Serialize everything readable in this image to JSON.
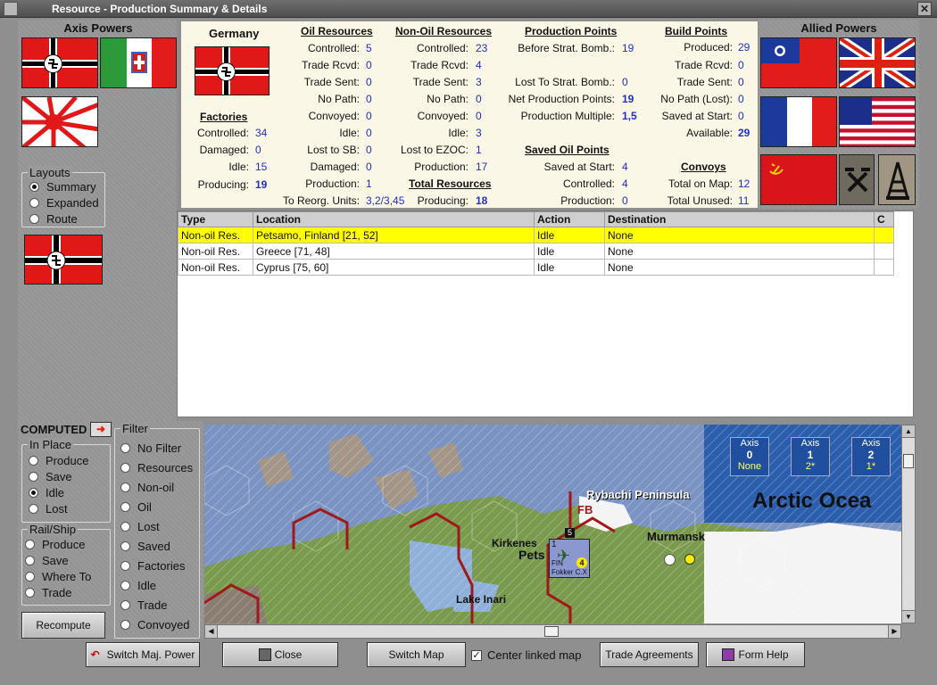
{
  "window": {
    "title": "Resource - Production Summary & Details",
    "close_glyph": "✕"
  },
  "axis_powers": {
    "title": "Axis Powers"
  },
  "allied_powers": {
    "title": "Allied Powers"
  },
  "summary": {
    "country": "Germany",
    "factories": {
      "title": "Factories",
      "rows": [
        {
          "label": "Controlled:",
          "value": "34"
        },
        {
          "label": "Damaged:",
          "value": "0"
        },
        {
          "label": "Idle:",
          "value": "15"
        },
        {
          "label": "Producing:",
          "value": "19"
        }
      ]
    },
    "oil": {
      "title": "Oil Resources",
      "rows": [
        {
          "label": "Controlled:",
          "value": "5"
        },
        {
          "label": "Trade Rcvd:",
          "value": "0"
        },
        {
          "label": "Trade Sent:",
          "value": "0"
        },
        {
          "label": "No Path:",
          "value": "0"
        },
        {
          "label": "Convoyed:",
          "value": "0"
        },
        {
          "label": "Idle:",
          "value": "0"
        },
        {
          "label": "Lost to SB:",
          "value": "0"
        },
        {
          "label": "Damaged:",
          "value": "0"
        },
        {
          "label": "Production:",
          "value": "1"
        },
        {
          "label": "To Reorg. Units:",
          "value": "3,2/3,45"
        }
      ]
    },
    "nonoil": {
      "title": "Non-Oil Resources",
      "rows": [
        {
          "label": "Controlled:",
          "value": "23"
        },
        {
          "label": "Trade Rcvd:",
          "value": "4"
        },
        {
          "label": "Trade Sent:",
          "value": "3"
        },
        {
          "label": "No Path:",
          "value": "0"
        },
        {
          "label": "Convoyed:",
          "value": "0"
        },
        {
          "label": "Idle:",
          "value": "3"
        },
        {
          "label": "Lost to EZOC:",
          "value": "1"
        },
        {
          "label": "Production:",
          "value": "17"
        }
      ]
    },
    "total": {
      "title": "Total Resources",
      "label": "Producing:",
      "value": "18"
    },
    "production_points": {
      "title": "Production Points",
      "rows": [
        {
          "label": "Before Strat. Bomb.:",
          "value": "19"
        },
        {
          "label": "Lost To Strat. Bomb.:",
          "value": "0"
        },
        {
          "label": "Net Production Points:",
          "value": "19"
        },
        {
          "label": "Production Multiple:",
          "value": "1,5"
        }
      ]
    },
    "saved_oil": {
      "title": "Saved Oil Points",
      "rows": [
        {
          "label": "Saved at Start:",
          "value": "4"
        },
        {
          "label": "Controlled:",
          "value": "4"
        },
        {
          "label": "Production:",
          "value": "0"
        }
      ]
    },
    "build_points": {
      "title": "Build Points",
      "rows": [
        {
          "label": "Produced:",
          "value": "29"
        },
        {
          "label": "Trade Rcvd:",
          "value": "0"
        },
        {
          "label": "Trade Sent:",
          "value": "0"
        },
        {
          "label": "No Path (Lost):",
          "value": "0"
        },
        {
          "label": "Saved at Start:",
          "value": "0"
        },
        {
          "label": "Available:",
          "value": "29"
        }
      ]
    },
    "convoys": {
      "title": "Convoys",
      "rows": [
        {
          "label": "Total on Map:",
          "value": "12"
        },
        {
          "label": "Total Unused:",
          "value": "11"
        }
      ]
    }
  },
  "layouts": {
    "title": "Layouts",
    "options": [
      "Summary",
      "Expanded",
      "Route"
    ],
    "selected": "Summary"
  },
  "table": {
    "columns": [
      "Type",
      "Location",
      "Action",
      "Destination",
      "C"
    ],
    "rows": [
      {
        "type": "Non-oil Res.",
        "location": "Petsamo, Finland [21, 52]",
        "action": "Idle",
        "destination": "None"
      },
      {
        "type": "Non-oil Res.",
        "location": "Greece [71, 48]",
        "action": "Idle",
        "destination": "None"
      },
      {
        "type": "Non-oil Res.",
        "location": "Cyprus [75, 60]",
        "action": "Idle",
        "destination": "None"
      }
    ]
  },
  "computed": {
    "label": "COMPUTED",
    "in_place": {
      "title": "In Place",
      "options": [
        "Produce",
        "Save",
        "Idle",
        "Lost"
      ],
      "selected": "Idle"
    },
    "rail_ship": {
      "title": "Rail/Ship",
      "options": [
        "Produce",
        "Save",
        "Where To",
        "Trade"
      ]
    },
    "recompute": "Recompute"
  },
  "filter": {
    "title": "Filter",
    "options": [
      "No Filter",
      "Resources",
      "Non-oil",
      "Oil",
      "Lost",
      "Saved",
      "Factories",
      "Idle",
      "Trade",
      "Convoyed"
    ]
  },
  "map": {
    "labels": {
      "rybachi": "Rybachi Peninsula",
      "ocean": "Arctic Ocea",
      "murmansk": "Murmansk",
      "kirkenes": "Kirkenes",
      "pets": "Pets",
      "inari": "Lake Inari",
      "fb": "FB"
    },
    "unit": {
      "strength_top": "1",
      "nation": "FIN",
      "name": "Fokker C.X",
      "value": "4",
      "stack": "5"
    },
    "axis_boxes": [
      {
        "label": "Axis",
        "num": "0",
        "sub": "None"
      },
      {
        "label": "Axis",
        "num": "1",
        "sub": "2*"
      },
      {
        "label": "Axis",
        "num": "2",
        "sub": "1*"
      }
    ]
  },
  "bottom": {
    "switch_major": "Switch Maj. Power",
    "close": "Close",
    "switch_map": "Switch Map",
    "center_linked": "Center linked map",
    "center_checked": true,
    "trade": "Trade Agreements",
    "form_help": "Form Help"
  },
  "colors": {
    "selected_row": "#ffff00",
    "value_blue": "#1f2fbf",
    "axis_box": "#1f4f9e"
  }
}
